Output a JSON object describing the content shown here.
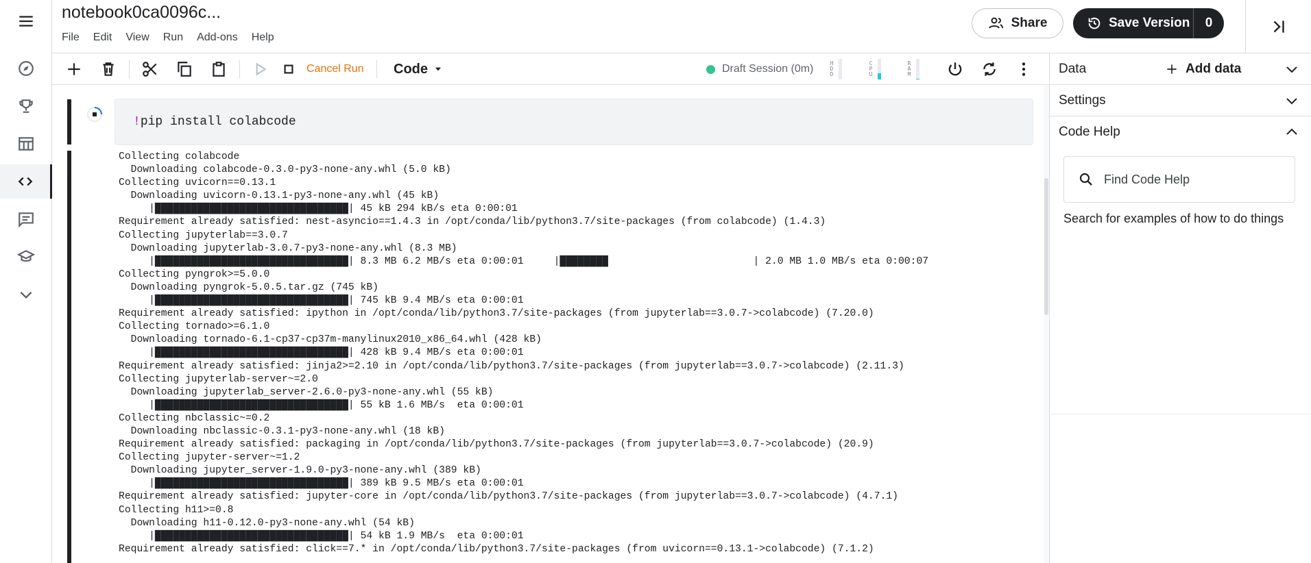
{
  "header": {
    "title": "notebook0ca0096c...",
    "menu": [
      "File",
      "Edit",
      "View",
      "Run",
      "Add-ons",
      "Help"
    ],
    "share_label": "Share",
    "save_version_label": "Save Version",
    "save_version_count": "0"
  },
  "rail": {
    "items": [
      "menu-icon",
      "compass-icon",
      "trophy-icon",
      "table-icon",
      "code-icon",
      "comment-icon",
      "school-icon",
      "chevron-down-icon"
    ],
    "active": "code-icon"
  },
  "toolbar": {
    "cancel_run_label": "Cancel Run",
    "cell_type": "Code",
    "session_status": "Draft Session (0m)",
    "meters": [
      {
        "label": "HDD",
        "level": 0.0
      },
      {
        "label": "CPU",
        "level": 0.3
      },
      {
        "label": "RAM",
        "level": 0.05
      }
    ]
  },
  "cell": {
    "bang": "!",
    "command": "pip install colabcode",
    "output": "Collecting colabcode\n  Downloading colabcode-0.3.0-py3-none-any.whl (5.0 kB)\nCollecting uvicorn==0.13.1\n  Downloading uvicorn-0.13.1-py3-none-any.whl (45 kB)\n     |████████████████████████████████| 45 kB 294 kB/s eta 0:00:01\nRequirement already satisfied: nest-asyncio==1.4.3 in /opt/conda/lib/python3.7/site-packages (from colabcode) (1.4.3)\nCollecting jupyterlab==3.0.7\n  Downloading jupyterlab-3.0.7-py3-none-any.whl (8.3 MB)\n     |████████████████████████████████| 8.3 MB 6.2 MB/s eta 0:00:01     |████████                        | 2.0 MB 1.0 MB/s eta 0:00:07\nCollecting pyngrok>=5.0.0\n  Downloading pyngrok-5.0.5.tar.gz (745 kB)\n     |████████████████████████████████| 745 kB 9.4 MB/s eta 0:00:01\nRequirement already satisfied: ipython in /opt/conda/lib/python3.7/site-packages (from jupyterlab==3.0.7->colabcode) (7.20.0)\nCollecting tornado>=6.1.0\n  Downloading tornado-6.1-cp37-cp37m-manylinux2010_x86_64.whl (428 kB)\n     |████████████████████████████████| 428 kB 9.4 MB/s eta 0:00:01\nRequirement already satisfied: jinja2>=2.10 in /opt/conda/lib/python3.7/site-packages (from jupyterlab==3.0.7->colabcode) (2.11.3)\nCollecting jupyterlab-server~=2.0\n  Downloading jupyterlab_server-2.6.0-py3-none-any.whl (55 kB)\n     |████████████████████████████████| 55 kB 1.6 MB/s  eta 0:00:01\nCollecting nbclassic~=0.2\n  Downloading nbclassic-0.3.1-py3-none-any.whl (18 kB)\nRequirement already satisfied: packaging in /opt/conda/lib/python3.7/site-packages (from jupyterlab==3.0.7->colabcode) (20.9)\nCollecting jupyter-server~=1.2\n  Downloading jupyter_server-1.9.0-py3-none-any.whl (389 kB)\n     |████████████████████████████████| 389 kB 9.5 MB/s eta 0:00:01\nRequirement already satisfied: jupyter-core in /opt/conda/lib/python3.7/site-packages (from jupyterlab==3.0.7->colabcode) (4.7.1)\nCollecting h11>=0.8\n  Downloading h11-0.12.0-py3-none-any.whl (54 kB)\n     |████████████████████████████████| 54 kB 1.9 MB/s  eta 0:00:01\nRequirement already satisfied: click==7.* in /opt/conda/lib/python3.7/site-packages (from uvicorn==0.13.1->colabcode) (7.1.2)"
  },
  "panel": {
    "data_label": "Data",
    "add_data_label": "Add data",
    "settings_label": "Settings",
    "code_help_label": "Code Help",
    "search_placeholder": "Find Code Help",
    "search_hint": "Search for examples of how to do things"
  },
  "colors": {
    "accent_dark": "#202124",
    "cancel_orange": "#e8710a",
    "session_green": "#34c38f",
    "bang_purple": "#a626a4"
  }
}
